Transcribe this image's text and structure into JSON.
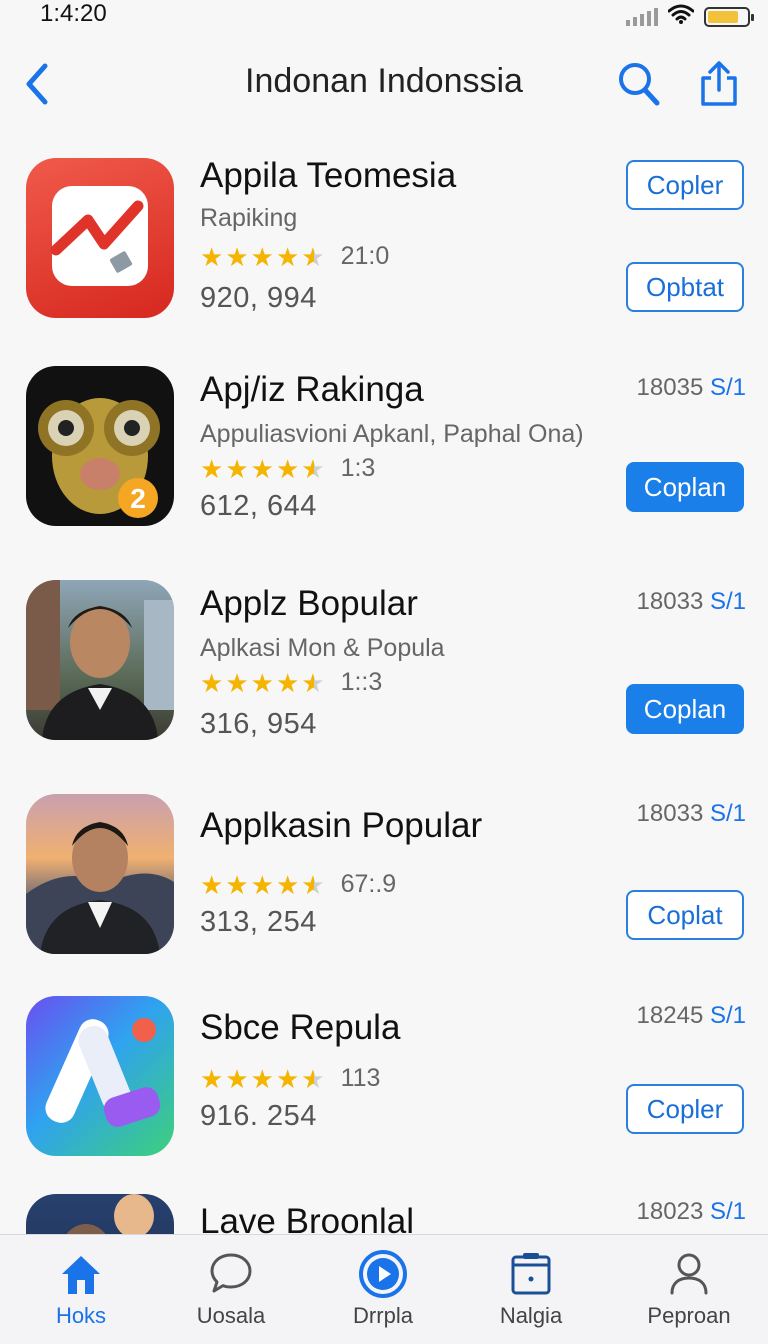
{
  "status_bar": {
    "time": "1:4:20"
  },
  "nav": {
    "title": "Indonan Indonssia"
  },
  "apps": [
    {
      "name": "Appila Teomesia",
      "subtitle": "Rapiking",
      "rating_text": "21:0",
      "rating": 4.5,
      "installs": "920, 994",
      "size_num": "",
      "size_unit": "",
      "buttons": [
        {
          "label": "Copler",
          "style": "outline"
        },
        {
          "label": "Opbtat",
          "style": "outline"
        }
      ]
    },
    {
      "name": "Apj/iz Rakinga",
      "subtitle": "Appuliasvioni Apkanl, Paphal Ona)",
      "rating_text": "1:3",
      "rating": 4.5,
      "installs": "612, 644",
      "size_num": "18035",
      "size_unit": "S/1",
      "buttons": [
        {
          "label": "Coplan",
          "style": "filled"
        }
      ]
    },
    {
      "name": "Applz Bopular",
      "subtitle": "Aplkasi Mon & Popula",
      "rating_text": "1::3",
      "rating": 4.5,
      "installs": "316, 954",
      "size_num": "18033",
      "size_unit": "S/1",
      "buttons": [
        {
          "label": "Coplan",
          "style": "filled"
        }
      ]
    },
    {
      "name": "Applkasin Popular",
      "subtitle": "",
      "rating_text": "67:.9",
      "rating": 4.5,
      "installs": "313, 254",
      "size_num": "18033",
      "size_unit": "S/1",
      "buttons": [
        {
          "label": "Coplat",
          "style": "outline"
        }
      ]
    },
    {
      "name": "Sbce Repula",
      "subtitle": "",
      "rating_text": "113",
      "rating": 4.5,
      "installs": "916. 254",
      "size_num": "18245",
      "size_unit": "S/1",
      "buttons": [
        {
          "label": "Copler",
          "style": "outline"
        }
      ]
    },
    {
      "name": "Lave Broonlal",
      "subtitle": "",
      "rating_text": "",
      "rating": 0,
      "installs": "",
      "size_num": "18023",
      "size_unit": "S/1",
      "buttons": []
    }
  ],
  "tabs": [
    {
      "label": "Hoks",
      "icon": "home-icon",
      "active": true
    },
    {
      "label": "Uosala",
      "icon": "chat-bubble-icon",
      "active": false
    },
    {
      "label": "Drrpla",
      "icon": "play-circle-icon",
      "active": false
    },
    {
      "label": "Nalgia",
      "icon": "folder-icon",
      "active": false
    },
    {
      "label": "Peproan",
      "icon": "person-icon",
      "active": false
    }
  ],
  "colors": {
    "accent": "#1a73e8",
    "star": "#f4b400",
    "badge": "#f5a623"
  }
}
